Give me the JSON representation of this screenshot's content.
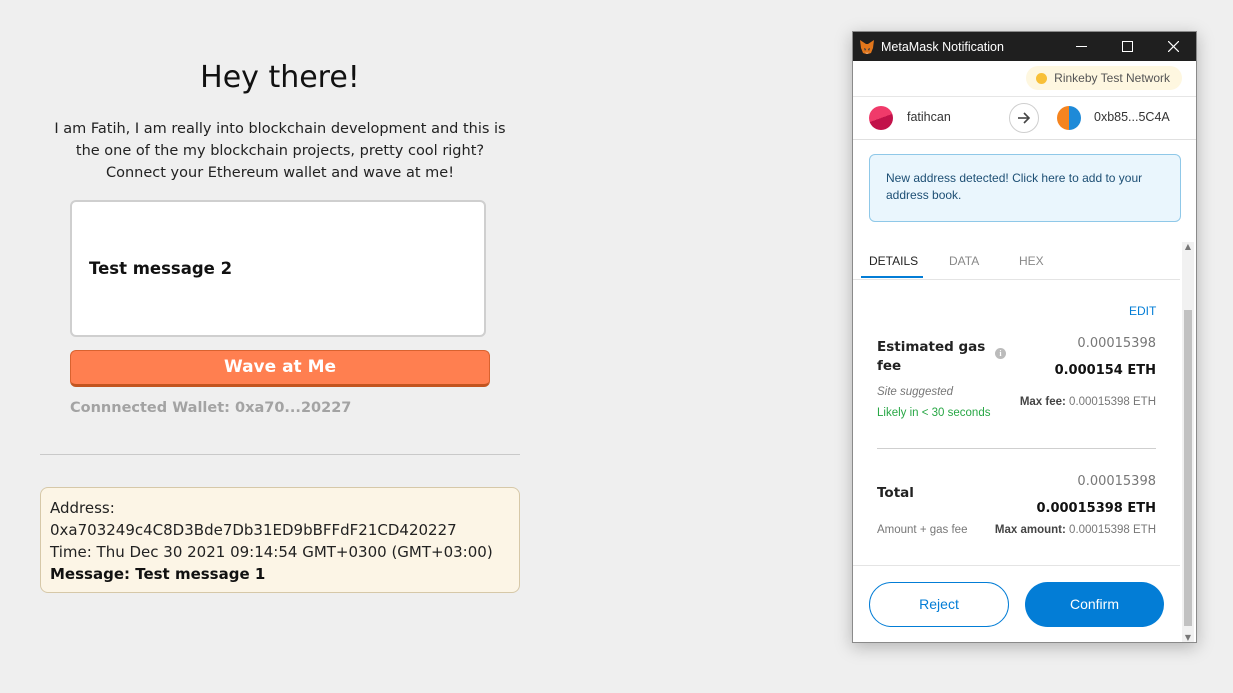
{
  "dapp": {
    "title": "Hey there!",
    "intro_lines": [
      "I am Fatih, I am really into blockchain development and this is",
      "the one of the my blockchain projects, pretty cool right?",
      "Connect your Ethereum wallet and wave at me!"
    ],
    "message_value": "Test message 2",
    "wave_button": "Wave at Me",
    "connected_wallet": "Connnected Wallet: 0xa70...20227",
    "wave_card": {
      "address_label": "Address:",
      "address": "0xa703249c4C8D3Bde7Db31ED9bBFFdF21CD420227",
      "time": "Time: Thu Dec 30 2021 09:14:54 GMT+0300 (GMT+03:00)",
      "message": "Message: Test message 1"
    }
  },
  "metamask": {
    "window_title": "MetaMask Notification",
    "network": "Rinkeby Test Network",
    "from_account": "fatihcan",
    "to_address": "0xb85...5C4A",
    "notice": "New address detected! Click here to add to your address book.",
    "tabs": [
      "DETAILS",
      "DATA",
      "HEX"
    ],
    "edit_label": "EDIT",
    "gas": {
      "label": "Estimated gas fee",
      "info_glyph": "i",
      "secondary": "0.00015398",
      "primary": "0.000154 ETH",
      "site_suggested": "Site suggested",
      "likely": "Likely in < 30 seconds",
      "max_fee_label": "Max fee:",
      "max_fee_value": "0.00015398 ETH"
    },
    "total": {
      "label": "Total",
      "secondary": "0.00015398",
      "primary": "0.00015398 ETH",
      "amount_gas": "Amount + gas fee",
      "max_amount_label": "Max amount:",
      "max_amount_value": "0.00015398 ETH"
    },
    "reject_label": "Reject",
    "confirm_label": "Confirm"
  },
  "colors": {
    "accent": "#037dd6",
    "wave_button": "#ff7f50",
    "network_dot": "#f8c038",
    "success": "#28a745"
  }
}
